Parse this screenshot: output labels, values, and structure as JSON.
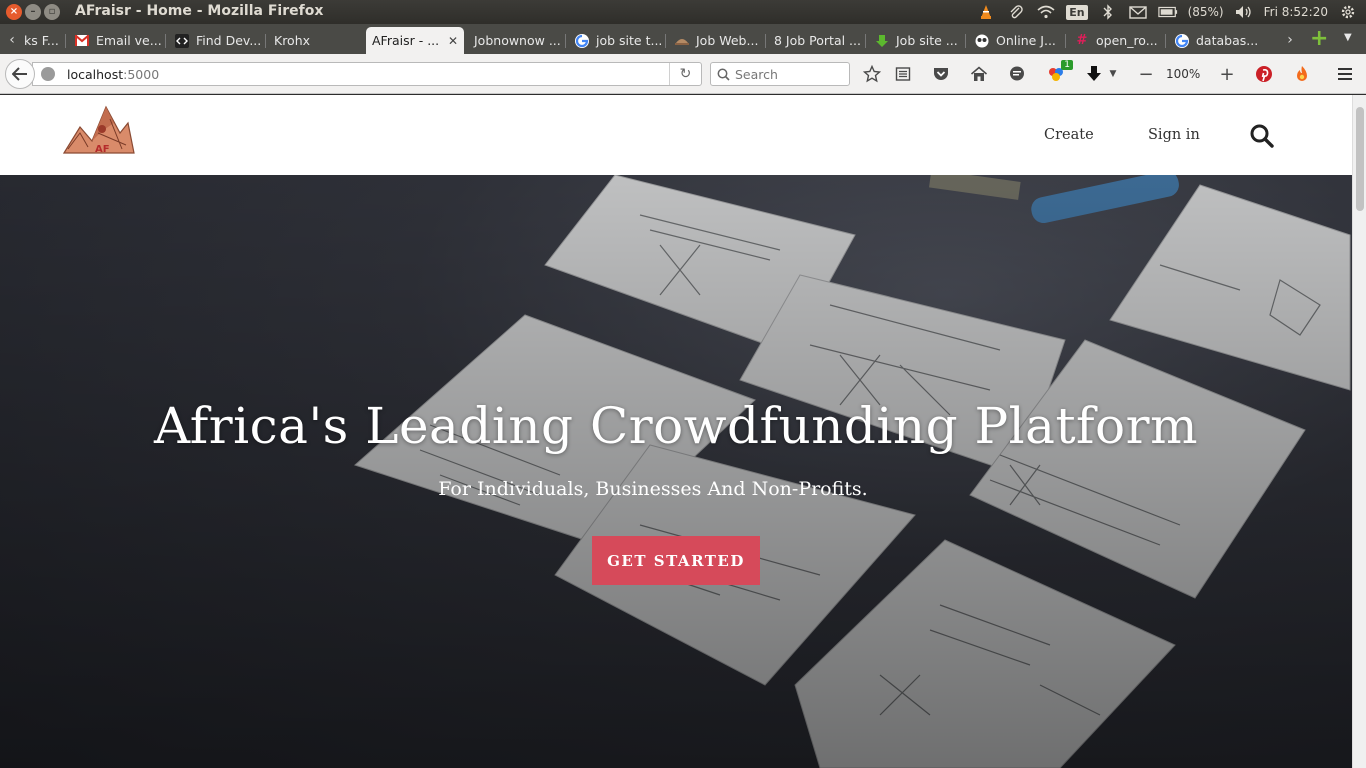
{
  "window": {
    "title": "AFraisr - Home - Mozilla Firefox",
    "tray": {
      "battery": "(85%)",
      "clock": "Fri  8:52:20",
      "keyboard": "En"
    }
  },
  "tabs": [
    {
      "label": "ks F...",
      "icon": "generic-icon"
    },
    {
      "label": "Email ve...",
      "icon": "gmail-icon"
    },
    {
      "label": "Find Dev...",
      "icon": "code-icon"
    },
    {
      "label": "Krohx",
      "icon": "none"
    },
    {
      "label": "AFraisr - ...",
      "icon": "none",
      "active": true
    },
    {
      "label": "Jobnownow ...",
      "icon": "none"
    },
    {
      "label": "job site t...",
      "icon": "google-icon"
    },
    {
      "label": "Job Web...",
      "icon": "hat-icon"
    },
    {
      "label": "8 Job Portal ...",
      "icon": "none"
    },
    {
      "label": "Job site ...",
      "icon": "download-arrow-icon"
    },
    {
      "label": "Online J...",
      "icon": "owl-icon"
    },
    {
      "label": "open_ro...",
      "icon": "slack-icon"
    },
    {
      "label": "databas...",
      "icon": "google-icon"
    }
  ],
  "navbar": {
    "url_host": "localhost",
    "url_port": ":5000",
    "search_placeholder": "Search",
    "zoom": "100%",
    "addon_badge": "1"
  },
  "site": {
    "nav": {
      "create": "Create",
      "signin": "Sign in"
    },
    "hero": {
      "title": "Africa's Leading Crowdfunding Platform",
      "subtitle": "For Individuals, Businesses And Non-Profits.",
      "cta": "GET STARTED"
    },
    "logo_text": "AF"
  },
  "colors": {
    "cta": "#d64a5a",
    "titlebar": "#3c3b37",
    "tabstrip": "#4a4a46",
    "hero_dark": "#2b2d34"
  }
}
